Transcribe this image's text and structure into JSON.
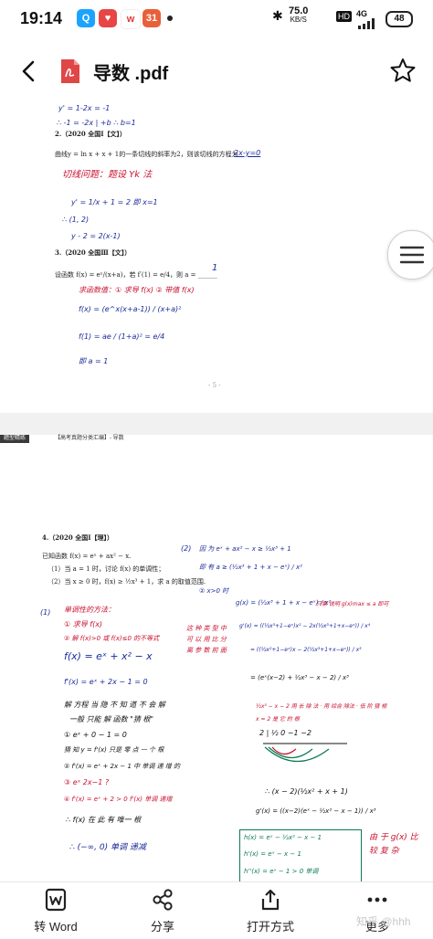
{
  "status_bar": {
    "time": "19:14",
    "app_badge": "31",
    "net_speed": "75.0",
    "net_unit": "KB/S",
    "hd": "HD",
    "signal": "4G",
    "battery": "48"
  },
  "header": {
    "title": "导数 .pdf"
  },
  "page1": {
    "hw_a": "y' = 1-2x = -1",
    "hw_b": "∴ -1 = -2x | +b ∴ b=1",
    "q2_head": "2.（2020 全国Ⅰ【文】）",
    "q2_text": "曲线y = ln x + x + 1的一条切线的斜率为2，则该切线的方程为",
    "q2_ans": "2x-y=0",
    "hw_c": "切线问题：题设 Yk 法",
    "hw_d": "y' = 1/x + 1 = 2  即 x=1",
    "hw_e": "∴ (1, 2)",
    "hw_f": "y - 2 = 2(x-1)",
    "q3_head": "3.（2020 全国Ⅲ【文】）",
    "q3_text": "设函数 f(x) = eˣ/(x+a)，若 f′(1) = e/4，则 a = ______",
    "q3_ans": "1",
    "hw_g": "求函数值：① 求导 f(x)    ② 带值 f(x)",
    "hw_h": "f(x) = (e^x(x+a-1)) / (x+a)²",
    "hw_i": "f(1) = ae / (1+a)² = e/4",
    "hw_j": "即 a = 1",
    "page_num": "- 5 -"
  },
  "page2": {
    "header_tag": "题型精练",
    "header_text": "【高考真题分类汇编】- 导数",
    "q4_head": "4.（2020 全国Ⅰ【理】）",
    "q4_l1": "已知函数 f(x) = eˣ + ax² − x.",
    "q4_l2": "（1）当 a = 1 时，讨论 f(x) 的单调性；",
    "q4_l3": "（2）当 x ≥ 0 时，f(x) ≥ ½x³ + 1，求 a 的取值范围.",
    "hw_part1": "(1)",
    "hw_r1": "单调性的方法：",
    "hw_r2": "① 求导 f(x)",
    "hw_r3": "② 解 f(x)>0 或 f(x)≤0 的不等式",
    "hw_b1": "f(x) = eˣ + x² − x",
    "hw_b2": "f'(x) = eˣ + 2x − 1 = 0",
    "hw_k1": "解 方程 当 隐 不 知 道 不 会 解",
    "hw_k2": "一般 只能 解 函数 \"猜 根\"",
    "hw_k3": "① eˣ + 0 − 1 = 0",
    "hw_k4": "猜 知 y = f'(x) 只是 零 点 一 个 根",
    "hw_k5": "② f'(x) = eˣ + 2x − 1  中 单调 递 增 的",
    "hw_r4": "③ eˣ   2x−1 ?",
    "hw_r5": "④ f'(x) = eˣ + 2 > 0   f'(x) 单调 递增",
    "hw_k6": "∴ f(x) 在 此 有 唯一 根",
    "hw_k7": "∴ (−∞, 0)  单调 递减",
    "hw_part2": "(2)",
    "hw_c1": "因 为 eˣ + ax² − x ≥ ½x³ + 1",
    "hw_c2": "即 有 a ≥ (½x³ + 1 + x − eˣ) / x²",
    "hw_c3": "② x>0 时",
    "hw_c4": "g(x) = (½x³ + 1 + x − eˣ) / x²",
    "hw_rr1": "只需 说明 g(x)max ≤ a 即可",
    "hw_rr2": "这 种 类 型 中 可 以 用 比 分 离 参 数 前 面",
    "hw_c5": "g'(x) = ((½x³+1−eˣ)x² − 2x(½x³+1+x−eˣ)) / x⁴",
    "hw_c6": "= ((½x²+1−eˣ)x − 2(½x³+1+x−eˣ)) / x³",
    "hw_c7": "= (eˣ(x−2) + ½x³ − x − 2) / x³",
    "hw_rr3": "½x³ − x − 2  用 长 除 法 · 用 综合 除法 · 低 阶 猜 根",
    "hw_rr4": "x = 2 是 它 的 根",
    "hw_rr5": "2 | ½  0  −1  −2",
    "hw_c8": "∴ (x − 2)(½x² + x + 1)",
    "hw_c9": "g'(x) = ((x−2)(eˣ − ½x² − x − 1)) / x³",
    "hw_g1": "h(x) = eˣ − ½x² − x − 1",
    "hw_g2": "h'(x) = eˣ − x − 1",
    "hw_g3": "h''(x) = eˣ − 1 > 0 单调",
    "hw_rr6": "由 于 g(x) 比 较 复 杂"
  },
  "bottom_bar": {
    "items": [
      {
        "label": "转 Word",
        "icon": "word-icon"
      },
      {
        "label": "分享",
        "icon": "share-icon"
      },
      {
        "label": "打开方式",
        "icon": "open-with-icon"
      },
      {
        "label": "更多",
        "icon": "more-icon"
      }
    ]
  },
  "watermark": "知乎 @hhh",
  "colors": {
    "ink_blue": "#1a2a9a",
    "ink_red": "#c8102e",
    "ink_green": "#0a7a50",
    "pdf_red": "#e04646"
  }
}
